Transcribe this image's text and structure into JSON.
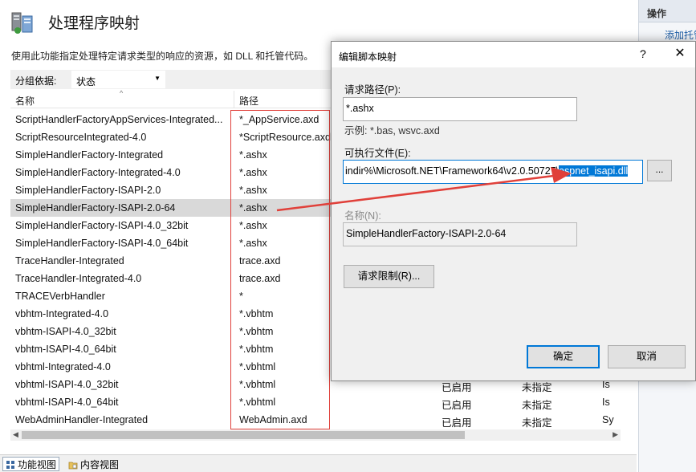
{
  "page": {
    "title": "处理程序映射",
    "description": "使用此功能指定处理特定请求类型的响应的资源，如 DLL 和托管代码。",
    "group_by_label": "分组依据:",
    "group_by_value": "状态"
  },
  "columns": {
    "name": "名称",
    "path": "路径"
  },
  "rows": [
    {
      "name": "ScriptHandlerFactoryAppServices-Integrated...",
      "path": "*_AppService.axd",
      "state": "",
      "type": "",
      "extra": ""
    },
    {
      "name": "ScriptResourceIntegrated-4.0",
      "path": "*ScriptResource.axd",
      "state": "",
      "type": "",
      "extra": ""
    },
    {
      "name": "SimpleHandlerFactory-Integrated",
      "path": "*.ashx",
      "state": "",
      "type": "",
      "extra": ""
    },
    {
      "name": "SimpleHandlerFactory-Integrated-4.0",
      "path": "*.ashx",
      "state": "",
      "type": "",
      "extra": ""
    },
    {
      "name": "SimpleHandlerFactory-ISAPI-2.0",
      "path": "*.ashx",
      "state": "",
      "type": "",
      "extra": ""
    },
    {
      "name": "SimpleHandlerFactory-ISAPI-2.0-64",
      "path": "*.ashx",
      "state": "",
      "type": "",
      "extra": "",
      "selected": true
    },
    {
      "name": "SimpleHandlerFactory-ISAPI-4.0_32bit",
      "path": "*.ashx",
      "state": "",
      "type": "",
      "extra": ""
    },
    {
      "name": "SimpleHandlerFactory-ISAPI-4.0_64bit",
      "path": "*.ashx",
      "state": "",
      "type": "",
      "extra": ""
    },
    {
      "name": "TraceHandler-Integrated",
      "path": "trace.axd",
      "state": "",
      "type": "",
      "extra": ""
    },
    {
      "name": "TraceHandler-Integrated-4.0",
      "path": "trace.axd",
      "state": "",
      "type": "",
      "extra": ""
    },
    {
      "name": "TRACEVerbHandler",
      "path": "*",
      "state": "",
      "type": "",
      "extra": ""
    },
    {
      "name": "vbhtm-Integrated-4.0",
      "path": "*.vbhtm",
      "state": "",
      "type": "",
      "extra": ""
    },
    {
      "name": "vbhtm-ISAPI-4.0_32bit",
      "path": "*.vbhtm",
      "state": "",
      "type": "",
      "extra": ""
    },
    {
      "name": "vbhtm-ISAPI-4.0_64bit",
      "path": "*.vbhtm",
      "state": "",
      "type": "",
      "extra": ""
    },
    {
      "name": "vbhtml-Integrated-4.0",
      "path": "*.vbhtml",
      "state": "",
      "type": "",
      "extra": ""
    },
    {
      "name": "vbhtml-ISAPI-4.0_32bit",
      "path": "*.vbhtml",
      "state": "已启用",
      "type": "未指定",
      "extra": "Is"
    },
    {
      "name": "vbhtml-ISAPI-4.0_64bit",
      "path": "*.vbhtml",
      "state": "已启用",
      "type": "未指定",
      "extra": "Is"
    },
    {
      "name": "WebAdminHandler-Integrated",
      "path": "WebAdmin.axd",
      "state": "已启用",
      "type": "未指定",
      "extra": "Sy"
    }
  ],
  "bottom_tabs": {
    "features": "功能视图",
    "content": "内容视图"
  },
  "actions": {
    "title": "操作",
    "add": "添加托管"
  },
  "dialog": {
    "title": "编辑脚本映射",
    "help": "?",
    "close": "✕",
    "request_path_label": "请求路径(P):",
    "request_path_value": "*.ashx",
    "request_path_hint": "示例: *.bas, wsvc.axd",
    "executable_label": "可执行文件(E):",
    "executable_prefix": "indir%\\Microsoft.NET\\Framework64\\v2.0.50727\\",
    "executable_selected": "aspnet_isapi.dll",
    "browse": "...",
    "name_label": "名称(N):",
    "name_value": "SimpleHandlerFactory-ISAPI-2.0-64",
    "request_limit": "请求限制(R)...",
    "ok": "确定",
    "cancel": "取消"
  },
  "colors": {
    "accent": "#0078d7",
    "annotation": "#e0403a",
    "selected_row": "#d9d9d9"
  }
}
